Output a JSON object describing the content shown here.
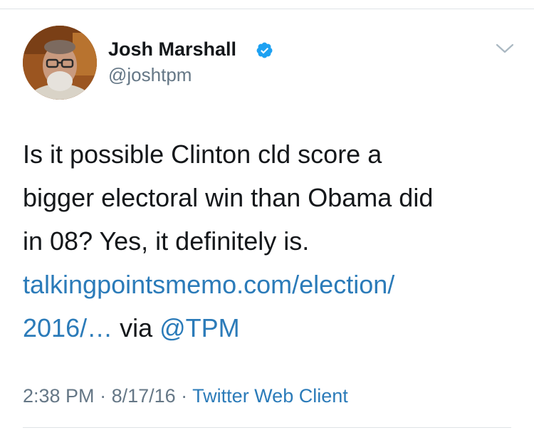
{
  "author": {
    "display_name": "Josh Marshall",
    "handle": "@joshtpm",
    "verified": true,
    "avatar_icon": "profile-photo"
  },
  "tweet": {
    "text_line1": "Is it possible Clinton cld score a",
    "text_line2": "bigger electoral win than Obama did",
    "text_line3": "in 08? Yes, it definitely is.",
    "link_line1": "talkingpointsmemo.com/election/",
    "link_line2": "2016/…",
    "via_text": " via ",
    "mention": "@TPM"
  },
  "meta": {
    "time": "2:38 PM",
    "separator": " · ",
    "date": "8/17/16",
    "source": "Twitter Web Client"
  },
  "icons": {
    "verified": "verified-badge-icon",
    "menu": "chevron-down-icon"
  },
  "colors": {
    "link": "#2b7bb9",
    "secondary_text": "#657786",
    "verified_badge": "#1da1f2"
  }
}
